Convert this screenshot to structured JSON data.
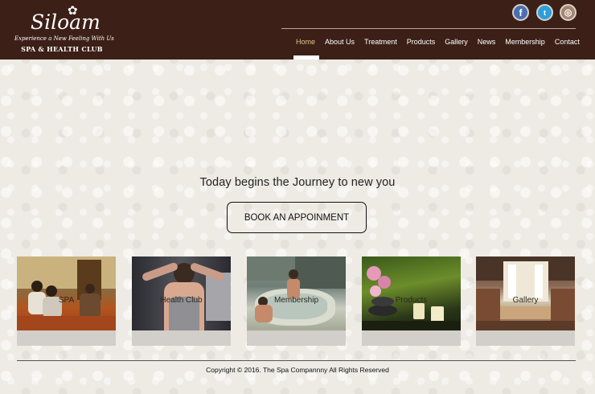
{
  "brand": {
    "name": "Siloam",
    "tagline": "Experience a New Feeling With Us",
    "subtitle": "SPA & HEALTH CLUB"
  },
  "social": {
    "facebook_icon": "f",
    "twitter_icon": "t",
    "instagram_icon": "◎"
  },
  "nav": {
    "items": [
      {
        "label": "Home",
        "active": true
      },
      {
        "label": "About Us"
      },
      {
        "label": "Treatment"
      },
      {
        "label": "Products"
      },
      {
        "label": "Gallery"
      },
      {
        "label": "News"
      },
      {
        "label": "Membership"
      },
      {
        "label": "Contact"
      }
    ]
  },
  "hero": {
    "headline": "Today begins the Journey to new you",
    "button_label": "BOOK AN APPOINMENT"
  },
  "cards": [
    {
      "label": "SPA"
    },
    {
      "label": "Health Club"
    },
    {
      "label": "Membership"
    },
    {
      "label": "Products"
    },
    {
      "label": "Gallery"
    }
  ],
  "footer": {
    "copyright": "Copyright © 2016. The Spa Compannny All Rights Reserved"
  },
  "colors": {
    "header_bg": "#3c1f17",
    "nav_active": "#e8c48a",
    "page_bg": "#eeebe5"
  }
}
